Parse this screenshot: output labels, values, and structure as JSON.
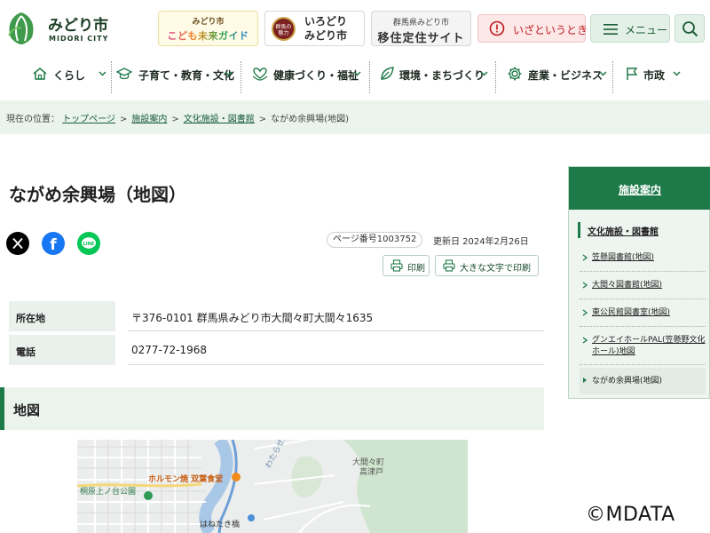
{
  "header": {
    "logo_name": "みどり市",
    "logo_sub": "MIDORI CITY",
    "banners": {
      "kids_top": "みどり市",
      "kids_bottom": "こども未来ガイド",
      "iro_badge": "群馬の魅力",
      "iro_line1": "いろどり",
      "iro_line2": "みどり市",
      "iju_top": "群馬県みどり市",
      "iju_bottom": "移住定住サイト"
    },
    "emergency_label": "いざというとき",
    "menu_label": "メニュー",
    "colors": {
      "brand": "#1e7a48",
      "emergency": "#c0181f"
    }
  },
  "gnav": {
    "items": [
      {
        "label": "くらし",
        "icon": "home-icon"
      },
      {
        "label": "子育て・教育・文化",
        "icon": "graduation-cap-icon"
      },
      {
        "label": "健康づくり・福祉",
        "icon": "heart-hands-icon"
      },
      {
        "label": "環境・まちづくり",
        "icon": "leaf-icon"
      },
      {
        "label": "産業・ビジネス",
        "icon": "gear-icon"
      },
      {
        "label": "市政",
        "icon": "flag-icon"
      }
    ]
  },
  "breadcrumb": {
    "prefix": "現在の位置：",
    "links": [
      "トップページ",
      "施設案内",
      "文化施設・図書館"
    ],
    "current": "ながめ余興場(地図)",
    "separator": ">"
  },
  "main": {
    "title": "ながめ余興場（地図）",
    "page_number": "ページ番号1003752",
    "updated": "更新日 2024年2月26日",
    "print_label": "印刷",
    "large_print_label": "大きな文字で印刷",
    "social": {
      "x": "X",
      "facebook": "f",
      "line": "LINE"
    },
    "info": [
      {
        "head": "所在地",
        "value": "〒376-0101 群馬県みどり市大間々町大間々1635"
      },
      {
        "head": "電話",
        "value": "0277-72-1968"
      }
    ],
    "section_title": "地図"
  },
  "map": {
    "labels": {
      "restaurant": "ホルモン焼 双葉食堂",
      "park": "桐原上ノ台公園",
      "town": "大間々町",
      "area": "高津戸",
      "bridge": "はねたき橋",
      "river": "わたらせ渓谷"
    }
  },
  "sidebar": {
    "title": "施設案内",
    "category": "文化施設・図書館",
    "items": [
      {
        "label": "笠懸図書館(地図)"
      },
      {
        "label": "大間々図書館(地図)"
      },
      {
        "label": "東公民館図書室(地図)"
      },
      {
        "label": "グンエイホールPAL(笠懸野文化ホール)地図"
      },
      {
        "label": "ながめ余興場(地図)",
        "current": true
      }
    ]
  },
  "watermark": "©MDATA"
}
